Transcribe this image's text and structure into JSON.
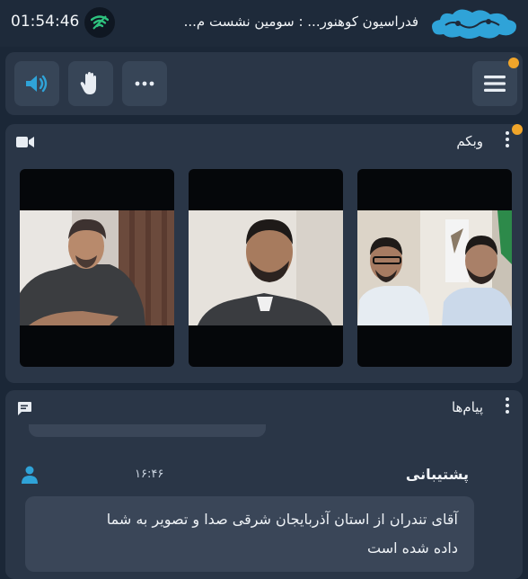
{
  "status_bar": {
    "time": "01:54:46",
    "title": "فدراسیون کوهنور...  :  سومین نشست م..."
  },
  "controls": {
    "speaker_icon": "speaker-icon",
    "hand_icon": "raise-hand-icon",
    "more_icon": "more-dots-icon",
    "menu_icon": "hamburger-menu-icon"
  },
  "webcam_panel": {
    "title": "وبکم",
    "video_icon": "video-camera-icon",
    "participants": [
      "participant-1",
      "participant-2",
      "participant-3"
    ]
  },
  "messages_panel": {
    "title": "پیام‌ها",
    "message": {
      "sender": "پشتیبانی",
      "time": "۱۶:۴۶",
      "text_line1": "آقای تندران از استان آذربایجان شرقی صدا و تصویر به شما",
      "text_line2": "داده شده است"
    }
  },
  "colors": {
    "background": "#1b2737",
    "panel": "#2a3647",
    "button": "#374557",
    "accent_blue": "#2fa3d8",
    "notification": "#f0a52a",
    "signal_green": "#2ec27e"
  }
}
